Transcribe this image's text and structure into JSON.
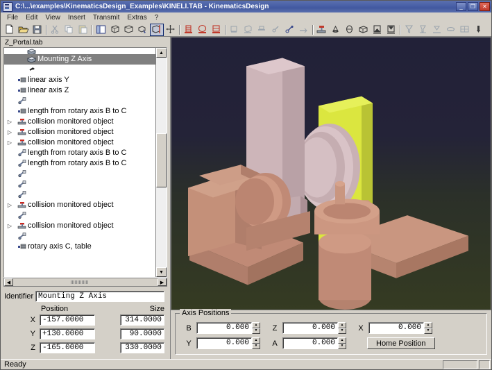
{
  "window": {
    "title": "C:\\...\\examples\\KinematicsDesign_Examples\\KINELI.TAB - KinematicsDesign",
    "icon": "app-icon",
    "minimize_label": "_",
    "maximize_label": "❐",
    "close_label": "✕"
  },
  "menu": {
    "items": [
      {
        "label": "File"
      },
      {
        "label": "Edit"
      },
      {
        "label": "View"
      },
      {
        "label": "Insert"
      },
      {
        "label": "Transmit"
      },
      {
        "label": "Extras"
      },
      {
        "label": "?"
      }
    ]
  },
  "toolbar": {
    "groups": [
      {
        "buttons": [
          {
            "name": "new-file-icon",
            "active": false
          },
          {
            "name": "open-file-icon",
            "active": false
          },
          {
            "name": "save-file-icon",
            "active": false
          }
        ]
      },
      {
        "buttons": [
          {
            "name": "cut-icon",
            "active": false
          },
          {
            "name": "copy-icon",
            "active": false
          },
          {
            "name": "paste-icon",
            "active": false
          }
        ]
      },
      {
        "buttons": [
          {
            "name": "tree-view-icon",
            "active": false
          },
          {
            "name": "rotate-object-icon",
            "active": false
          },
          {
            "name": "box-view-icon",
            "active": false
          },
          {
            "name": "pick-object-icon",
            "active": false
          },
          {
            "name": "measure-box-icon",
            "active": true
          },
          {
            "name": "move-axes-icon",
            "active": false
          }
        ]
      },
      {
        "buttons": [
          {
            "name": "machine-column-icon",
            "active": false
          },
          {
            "name": "machine-round-icon",
            "active": false
          },
          {
            "name": "machine-block-icon",
            "active": false
          }
        ]
      },
      {
        "buttons": [
          {
            "name": "linear-axis-x-icon",
            "active": false
          },
          {
            "name": "linear-axis-y-icon",
            "active": false
          },
          {
            "name": "linear-axis-z-icon",
            "active": false
          },
          {
            "name": "rotary-axis-icon",
            "active": false
          },
          {
            "name": "kinematic-chain-icon",
            "active": false
          },
          {
            "name": "tool-link-icon",
            "active": false
          }
        ]
      },
      {
        "buttons": [
          {
            "name": "collision-object-icon",
            "active": false
          },
          {
            "name": "cone-solid-icon",
            "active": false
          },
          {
            "name": "sphere-solid-icon",
            "active": false
          },
          {
            "name": "cube-solid-icon",
            "active": false
          },
          {
            "name": "workpiece-left-icon",
            "active": false
          },
          {
            "name": "workpiece-right-icon",
            "active": false
          }
        ]
      },
      {
        "buttons": [
          {
            "name": "filter-icon",
            "active": false
          },
          {
            "name": "fixture-icon",
            "active": false
          },
          {
            "name": "clamp-icon",
            "active": false
          },
          {
            "name": "table-icon",
            "active": false
          },
          {
            "name": "table-grid-icon",
            "active": false
          },
          {
            "name": "probe-icon",
            "active": false
          }
        ]
      }
    ]
  },
  "tab": {
    "label": "Z_Portal.tab"
  },
  "tree": {
    "rows": [
      {
        "label": "",
        "icon": "component-icon",
        "twist": "",
        "selected": false,
        "partial": true
      },
      {
        "label": "Mounting Z Axis",
        "icon": "component-icon",
        "twist": "",
        "selected": true
      },
      {
        "label": "",
        "icon": "link-small-icon",
        "twist": "",
        "selected": false
      },
      {
        "label": "linear axis Y",
        "icon": "linear-axis-icon",
        "twist": "",
        "selected": false
      },
      {
        "label": "linear axis Z",
        "icon": "linear-axis-icon",
        "twist": "",
        "selected": false
      },
      {
        "label": "",
        "icon": "rotary-axis-icon",
        "twist": "",
        "selected": false
      },
      {
        "label": "length from rotary axis B to C",
        "icon": "linear-axis-icon",
        "twist": "",
        "selected": false
      },
      {
        "label": "collision monitored object",
        "icon": "collision-icon",
        "twist": "▷",
        "selected": false
      },
      {
        "label": "collision monitored object",
        "icon": "collision-icon",
        "twist": "▷",
        "selected": false
      },
      {
        "label": "collision monitored object",
        "icon": "collision-icon",
        "twist": "▷",
        "selected": false
      },
      {
        "label": "length from rotary axis B to C",
        "icon": "rotary-axis-icon",
        "twist": "",
        "selected": false
      },
      {
        "label": "length from rotary axis B to C",
        "icon": "rotary-axis-icon",
        "twist": "",
        "selected": false
      },
      {
        "label": "",
        "icon": "rotary-axis-icon",
        "twist": "",
        "selected": false
      },
      {
        "label": "",
        "icon": "rotary-axis-icon",
        "twist": "",
        "selected": false
      },
      {
        "label": "",
        "icon": "rotary-axis-icon",
        "twist": "",
        "selected": false
      },
      {
        "label": "collision monitored object",
        "icon": "collision-icon",
        "twist": "▷",
        "selected": false
      },
      {
        "label": "",
        "icon": "rotary-axis-icon",
        "twist": "",
        "selected": false
      },
      {
        "label": "collision monitored object",
        "icon": "collision-icon",
        "twist": "▷",
        "selected": false
      },
      {
        "label": "",
        "icon": "rotary-axis-icon",
        "twist": "",
        "selected": false
      },
      {
        "label": "rotary axis C, table",
        "icon": "linear-axis-icon",
        "twist": "",
        "selected": false
      }
    ],
    "scroll_up": "▲",
    "scroll_down": "▼",
    "scroll_left": "◀",
    "scroll_right": "▶"
  },
  "properties": {
    "identifier_label": "Identifier",
    "identifier_value": "Mounting Z Axis",
    "position_header": "Position",
    "size_header": "Size",
    "axes": [
      {
        "label": "X",
        "position": "-157.0000",
        "size": "314.0000"
      },
      {
        "label": "Y",
        "position": "+130.0000",
        "size": "90.0000"
      },
      {
        "label": "Z",
        "position": "-165.0000",
        "size": "330.0000"
      }
    ]
  },
  "viewport": {
    "background_top": "#222138",
    "background_bottom": "#343a22",
    "body_color": "#d2bdbf",
    "plate_color": "#d6e13c",
    "base_color": "#c08a76"
  },
  "axis_positions": {
    "title": "Axis Positions",
    "row1": [
      {
        "label": "B",
        "value": "0.000"
      },
      {
        "label": "Z",
        "value": "0.000"
      },
      {
        "label": "X",
        "value": "0.000"
      }
    ],
    "row2": [
      {
        "label": "Y",
        "value": "0.000"
      },
      {
        "label": "A",
        "value": "0.000"
      }
    ],
    "home_button": "Home Position",
    "spin_up": "▲",
    "spin_down": "▼"
  },
  "status": {
    "text": "Ready"
  }
}
